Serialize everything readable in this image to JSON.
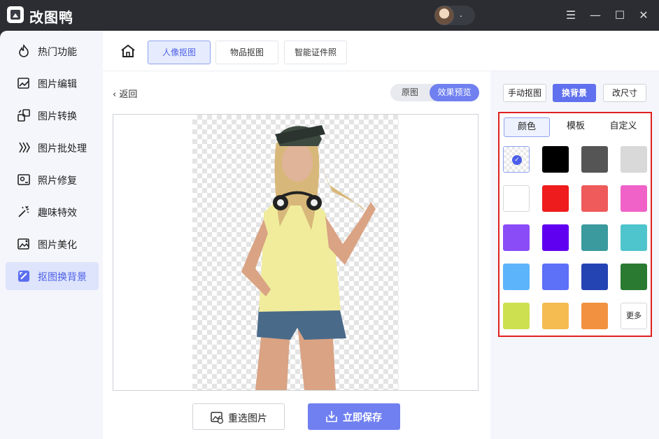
{
  "app": {
    "title": "改图鸭",
    "user_name": "."
  },
  "window": {
    "menu_icon": "menu-icon",
    "minimize_icon": "minimize-icon",
    "maximize_icon": "maximize-icon",
    "close_icon": "close-icon"
  },
  "sidebar": {
    "items": [
      {
        "label": "热门功能",
        "icon": "flame-icon",
        "active": false
      },
      {
        "label": "图片编辑",
        "icon": "image-edit-icon",
        "active": false
      },
      {
        "label": "图片转换",
        "icon": "convert-icon",
        "active": false
      },
      {
        "label": "图片批处理",
        "icon": "batch-icon",
        "active": false
      },
      {
        "label": "照片修复",
        "icon": "repair-icon",
        "active": false
      },
      {
        "label": "趣味特效",
        "icon": "magic-wand-icon",
        "active": false
      },
      {
        "label": "图片美化",
        "icon": "beautify-icon",
        "active": false
      },
      {
        "label": "抠图换背景",
        "icon": "cutout-icon",
        "active": true
      }
    ]
  },
  "topnav": {
    "home_icon": "home-icon",
    "tabs": [
      {
        "label": "人像抠图",
        "active": true
      },
      {
        "label": "物品抠图",
        "active": false
      },
      {
        "label": "智能证件照",
        "active": false
      }
    ]
  },
  "preview": {
    "back_label": "返回",
    "toggle": {
      "original": "原图",
      "preview": "效果预览"
    },
    "reselect_label": "重选图片",
    "save_label": "立即保存"
  },
  "right_panel": {
    "tools": [
      {
        "label": "手动抠图",
        "active": false
      },
      {
        "label": "换背景",
        "active": true
      },
      {
        "label": "改尺寸",
        "active": false
      }
    ],
    "sub_tabs": [
      {
        "label": "颜色",
        "active": true
      },
      {
        "label": "模板",
        "active": false
      },
      {
        "label": "自定义",
        "active": false
      }
    ],
    "colors": [
      [
        "transparent",
        "#000000",
        "#555555",
        "#d9d9d9"
      ],
      [
        "#ffffff",
        "#ee1c1c",
        "#ef5a5a",
        "#f062c8"
      ],
      [
        "#8a4cf6",
        "#6000f0",
        "#3a9a9e",
        "#4ec4cc"
      ],
      [
        "#5cb4fa",
        "#5c70f8",
        "#2544b4",
        "#2a7a32"
      ],
      [
        "#cce050",
        "#f5bc52",
        "#f29240",
        "more"
      ]
    ],
    "selected_color": "transparent",
    "more_label": "更多"
  }
}
